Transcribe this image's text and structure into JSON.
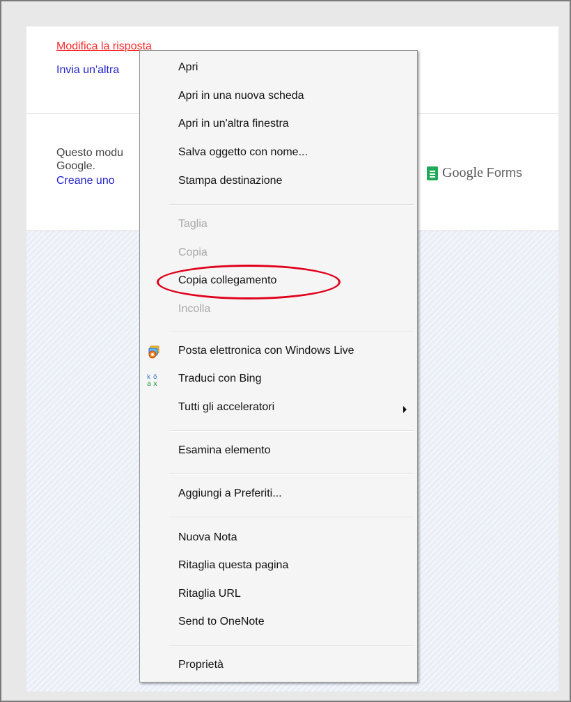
{
  "page": {
    "link_edit": "Modifica la risposta",
    "link_another": "Invia un'altra",
    "footer_line1": "Questo modu",
    "footer_line2": "Google.",
    "footer_line3": "Creane uno",
    "gforms_google": "Google",
    "gforms_forms": " Forms"
  },
  "menu": {
    "items": [
      {
        "label": "Apri",
        "disabled": false
      },
      {
        "label": "Apri in una nuova scheda",
        "disabled": false
      },
      {
        "label": "Apri in un'altra finestra",
        "disabled": false
      },
      {
        "label": "Salva oggetto con nome...",
        "disabled": false
      },
      {
        "label": "Stampa destinazione",
        "disabled": false
      },
      {
        "label": "Taglia",
        "disabled": true
      },
      {
        "label": "Copia",
        "disabled": true
      },
      {
        "label": "Copia collegamento",
        "disabled": false
      },
      {
        "label": "Incolla",
        "disabled": true
      },
      {
        "label": "Posta elettronica con Windows Live",
        "disabled": false,
        "icon": "windows-live-mail-icon"
      },
      {
        "label": "Traduci con Bing",
        "disabled": false,
        "icon": "bing-translate-icon"
      },
      {
        "label": "Tutti gli acceleratori",
        "disabled": false,
        "submenu": true
      },
      {
        "label": "Esamina elemento",
        "disabled": false
      },
      {
        "label": "Aggiungi a Preferiti...",
        "disabled": false
      },
      {
        "label": "Nuova Nota",
        "disabled": false
      },
      {
        "label": "Ritaglia questa pagina",
        "disabled": false
      },
      {
        "label": "Ritaglia URL",
        "disabled": false
      },
      {
        "label": "Send to OneNote",
        "disabled": false
      },
      {
        "label": "Proprietà",
        "disabled": false
      }
    ]
  },
  "colors": {
    "highlight": "#e0001a",
    "link_red": "#ff2a2a",
    "link_blue": "#2222cc",
    "forms_green": "#1faa58"
  }
}
